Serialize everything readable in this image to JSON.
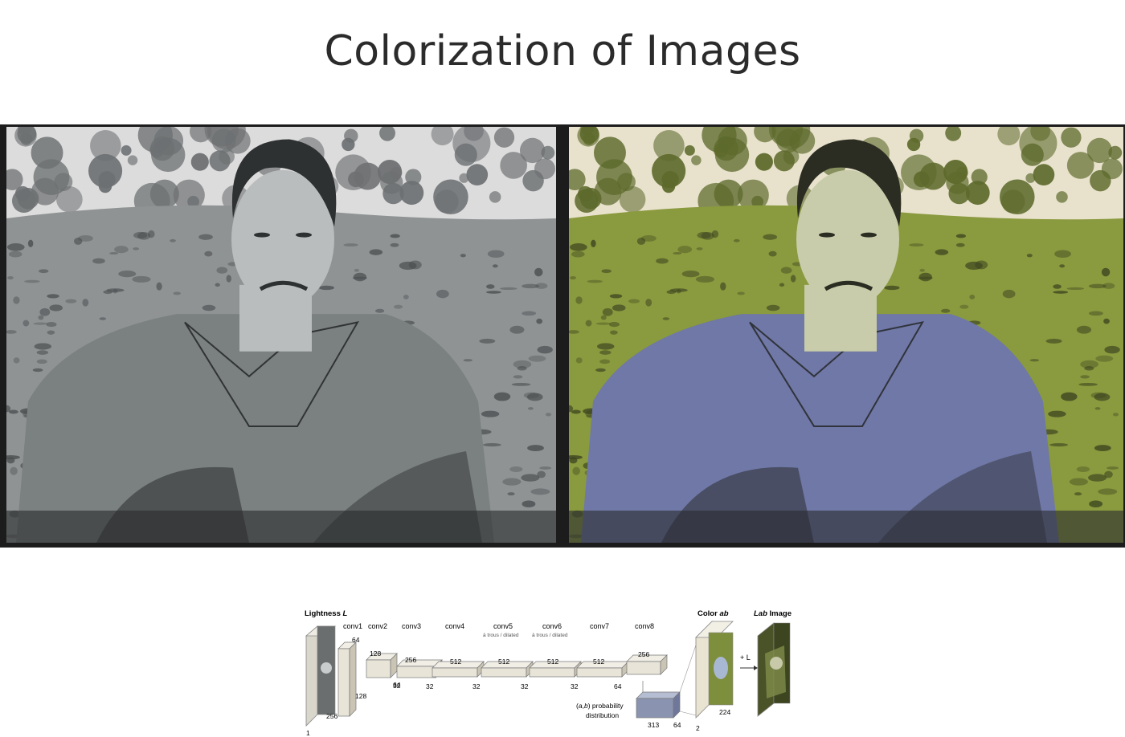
{
  "slide": {
    "title": "Colorization of Images"
  },
  "photos": [
    {
      "id": "original",
      "palette": {
        "sky": "#dcdcdc",
        "foliage": "#6d7072",
        "grass": "#8f9394",
        "grass_dark": "#4a4d4e",
        "skin": "#b9bdbd",
        "shirt": "#7b8081",
        "hair": "#2e3132",
        "shadow": "#2a2c2d"
      }
    },
    {
      "id": "colorized",
      "palette": {
        "sky": "#e8e2cc",
        "foliage": "#5d6a2c",
        "grass": "#8a9a3e",
        "grass_dark": "#3c4420",
        "skin": "#c8ccaa",
        "shirt": "#6f78a6",
        "hair": "#2c2d22",
        "shadow": "#2a2c30"
      }
    }
  ],
  "diagram": {
    "input_label": "Lightness",
    "input_label_var": "L",
    "output_label": "Color",
    "output_label_var": "ab",
    "result_label_var": "Lab",
    "result_label": "Image",
    "plus_l": "+ L",
    "layers": [
      {
        "name": "conv1",
        "sub": "",
        "channels": "64",
        "spatial": "128"
      },
      {
        "name": "conv2",
        "sub": "",
        "channels": "128",
        "spatial": "64"
      },
      {
        "name": "conv3",
        "sub": "",
        "channels": "256",
        "spatial": "32"
      },
      {
        "name": "conv4",
        "sub": "",
        "channels": "512",
        "spatial": "32"
      },
      {
        "name": "conv5",
        "sub": "à trous / dilated",
        "channels": "512",
        "spatial": "32"
      },
      {
        "name": "conv6",
        "sub": "à trous / dilated",
        "channels": "512",
        "spatial": "32"
      },
      {
        "name": "conv7",
        "sub": "",
        "channels": "512",
        "spatial": "32"
      },
      {
        "name": "conv8",
        "sub": "",
        "channels": "256",
        "spatial": "64"
      }
    ],
    "input_dims": {
      "depth": "1",
      "size": "256"
    },
    "prob": {
      "label_a": "a",
      "label_b": "b",
      "label_rest": "probability",
      "label2": "distribution",
      "channels": "313",
      "spatial": "64"
    },
    "output_dims": {
      "depth": "2",
      "size": "224"
    },
    "colors": {
      "block": "#e8e4d8",
      "block_side": "#c9c4b4",
      "prob": "#8a94b0",
      "stroke": "#777777"
    }
  }
}
